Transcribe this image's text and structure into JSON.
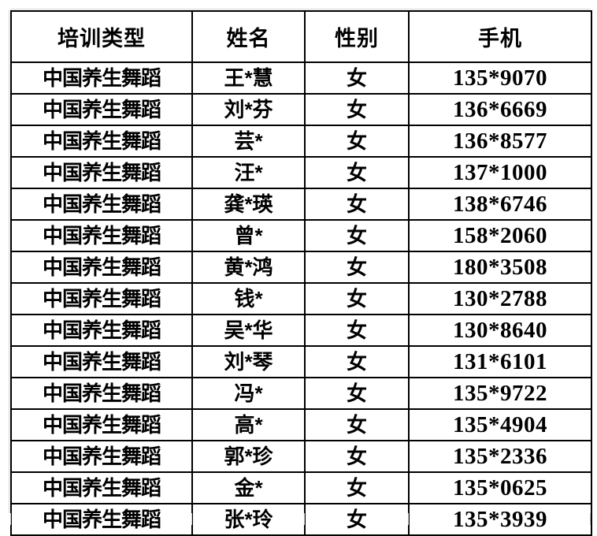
{
  "document": {
    "kind": "roster-table",
    "background_color": "#ffffff",
    "border_color": "#000000",
    "text_color": "#000000",
    "ghost_line_color": "#d7d7d7"
  },
  "table": {
    "columns": [
      {
        "key": "type",
        "header": "培训类型"
      },
      {
        "key": "name",
        "header": "姓名"
      },
      {
        "key": "gender",
        "header": "性别"
      },
      {
        "key": "phone",
        "header": "手机"
      }
    ],
    "rows": [
      {
        "type": "中国养生舞蹈",
        "name": "王*慧",
        "gender": "女",
        "phone": "135*9070"
      },
      {
        "type": "中国养生舞蹈",
        "name": "刘*芬",
        "gender": "女",
        "phone": "136*6669"
      },
      {
        "type": "中国养生舞蹈",
        "name": "芸*",
        "gender": "女",
        "phone": "136*8577"
      },
      {
        "type": "中国养生舞蹈",
        "name": "汪*",
        "gender": "女",
        "phone": "137*1000"
      },
      {
        "type": "中国养生舞蹈",
        "name": "龚*瑛",
        "gender": "女",
        "phone": "138*6746"
      },
      {
        "type": "中国养生舞蹈",
        "name": "曾*",
        "gender": "女",
        "phone": "158*2060"
      },
      {
        "type": "中国养生舞蹈",
        "name": "黄*鸿",
        "gender": "女",
        "phone": "180*3508"
      },
      {
        "type": "中国养生舞蹈",
        "name": "钱*",
        "gender": "女",
        "phone": "130*2788"
      },
      {
        "type": "中国养生舞蹈",
        "name": "吴*华",
        "gender": "女",
        "phone": "130*8640"
      },
      {
        "type": "中国养生舞蹈",
        "name": "刘*琴",
        "gender": "女",
        "phone": "131*6101"
      },
      {
        "type": "中国养生舞蹈",
        "name": "冯*",
        "gender": "女",
        "phone": "135*9722"
      },
      {
        "type": "中国养生舞蹈",
        "name": "高*",
        "gender": "女",
        "phone": "135*4904"
      },
      {
        "type": "中国养生舞蹈",
        "name": "郭*珍",
        "gender": "女",
        "phone": "135*2336"
      },
      {
        "type": "中国养生舞蹈",
        "name": "金*",
        "gender": "女",
        "phone": "135*0625"
      },
      {
        "type": "中国养生舞蹈",
        "name": "张*玲",
        "gender": "女",
        "phone": "135*3939"
      }
    ],
    "row_count": 15
  }
}
